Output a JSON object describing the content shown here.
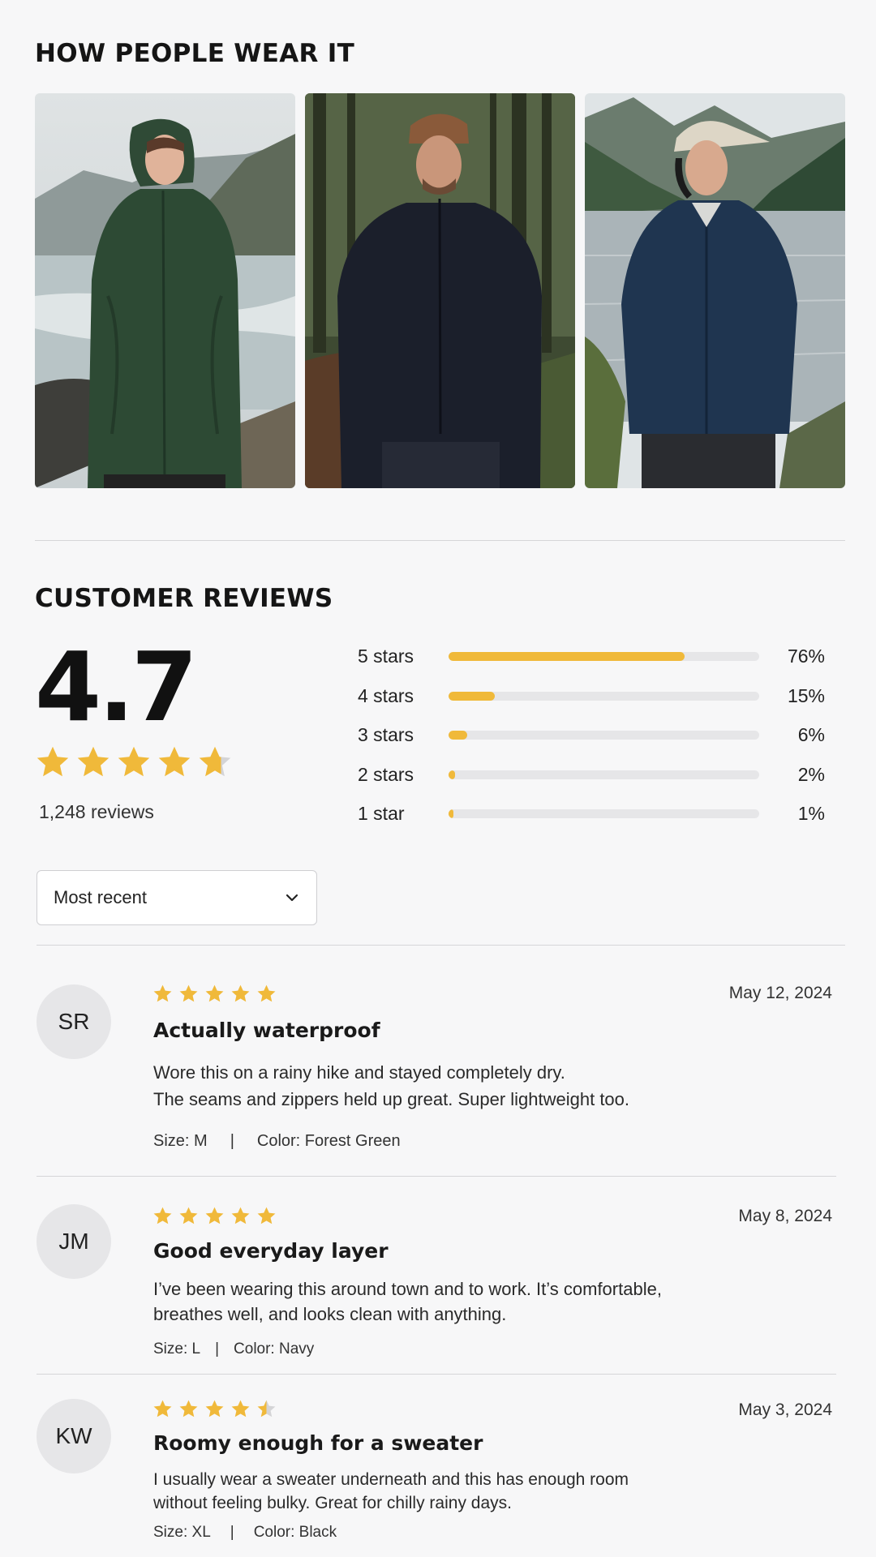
{
  "wear_section": {
    "title": "HOW PEOPLE WEAR IT",
    "photos": [
      {
        "alt": "Woman in a green hooded rain jacket on a coastal trail"
      },
      {
        "alt": "Man in a black rain jacket and beanie in a forest"
      },
      {
        "alt": "Woman in a navy rain jacket and cap by a lake"
      }
    ]
  },
  "reviews_section": {
    "title": "CUSTOMER REVIEWS",
    "average": "4.7",
    "average_value": 4.7,
    "review_count": "1,248 reviews",
    "breakdown": [
      {
        "label": "5 stars",
        "percent_text": "76%",
        "percent": 76
      },
      {
        "label": "4 stars",
        "percent_text": "15%",
        "percent": 15
      },
      {
        "label": "3 stars",
        "percent_text": "6%",
        "percent": 6
      },
      {
        "label": "2 stars",
        "percent_text": "2%",
        "percent": 2
      },
      {
        "label": "1 star",
        "percent_text": "1%",
        "percent": 1
      }
    ],
    "sort": {
      "selected": "Most recent"
    }
  },
  "reviews": [
    {
      "initials": "SR",
      "rating": 5,
      "date": "May 12, 2024",
      "title": "Actually waterproof",
      "body_line1": "Wore this on a rainy hike and stayed completely dry.",
      "body_line2": "The seams and zippers held up great. Super lightweight too.",
      "size": "Size: M",
      "color": "Color: Forest Green"
    },
    {
      "initials": "JM",
      "rating": 5,
      "date": "May 8, 2024",
      "title": "Good everyday layer",
      "body_line1": "I’ve been wearing this around town and to work. It’s comfortable,",
      "body_line2": "breathes well, and looks clean with anything.",
      "size": "Size: L",
      "color": "Color: Navy"
    },
    {
      "initials": "KW",
      "rating": 4.5,
      "date": "May 3, 2024",
      "title": "Roomy enough for a sweater",
      "body_line1": "I usually wear a sweater underneath and this has enough room",
      "body_line2": "without feeling bulky. Great for chilly rainy days.",
      "size": "Size: XL",
      "color": "Color: Black"
    }
  ],
  "colors": {
    "star": "#f0b93a",
    "star_empty": "#d4d4d6",
    "track": "#e6e6e8"
  },
  "icons": {
    "star": "star-icon",
    "half_star": "half-star-icon",
    "dropdown": "chevron-down-icon"
  }
}
